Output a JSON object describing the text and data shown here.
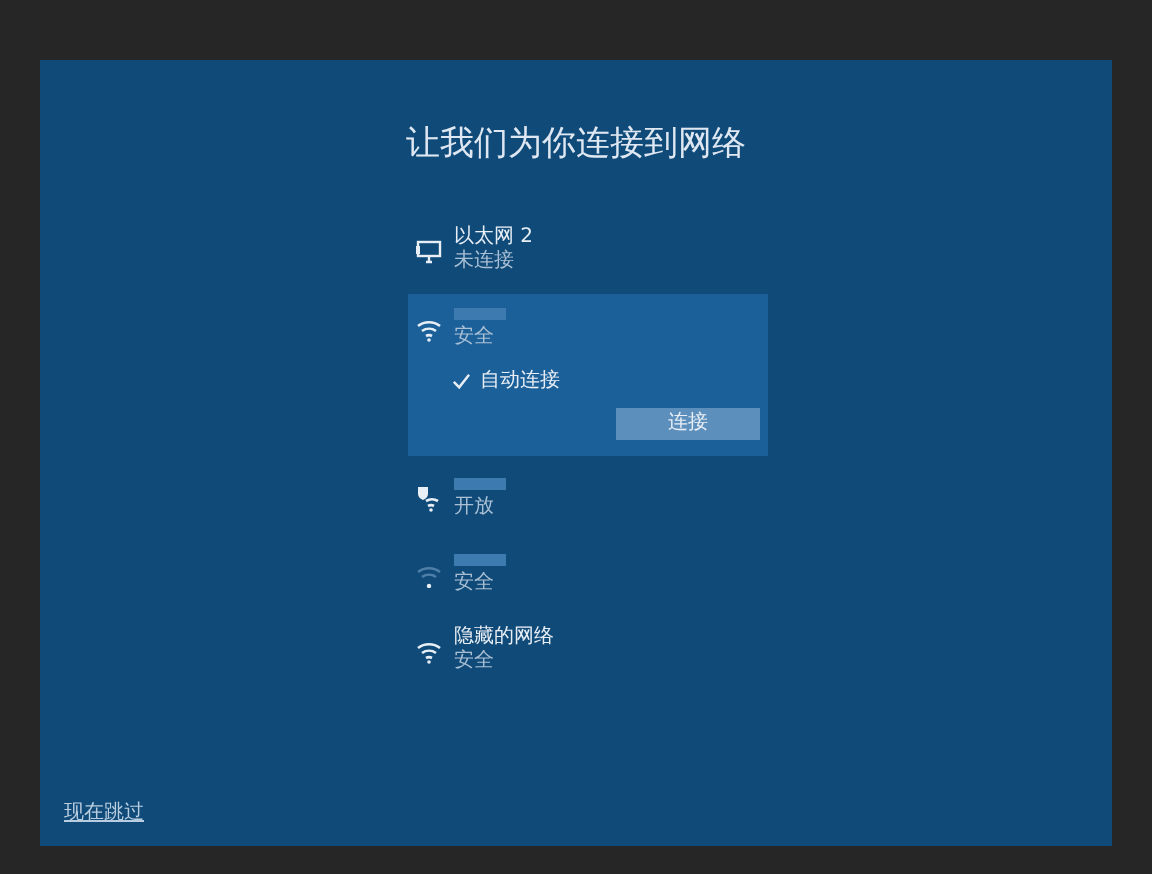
{
  "title": "让我们为你连接到网络",
  "networks": [
    {
      "kind": "ethernet",
      "name": "以太网 2",
      "status": "未连接",
      "selected": false
    },
    {
      "kind": "wifi",
      "status": "安全",
      "selected": true,
      "auto_connect": {
        "label": "自动连接",
        "checked": true
      },
      "connect_button": "连接"
    },
    {
      "kind": "wifi-open",
      "status": "开放",
      "selected": false
    },
    {
      "kind": "wifi-weak",
      "status": "安全",
      "selected": false
    },
    {
      "kind": "wifi",
      "name": "隐藏的网络",
      "status": "安全",
      "selected": false
    }
  ],
  "skip_link": "现在跳过"
}
